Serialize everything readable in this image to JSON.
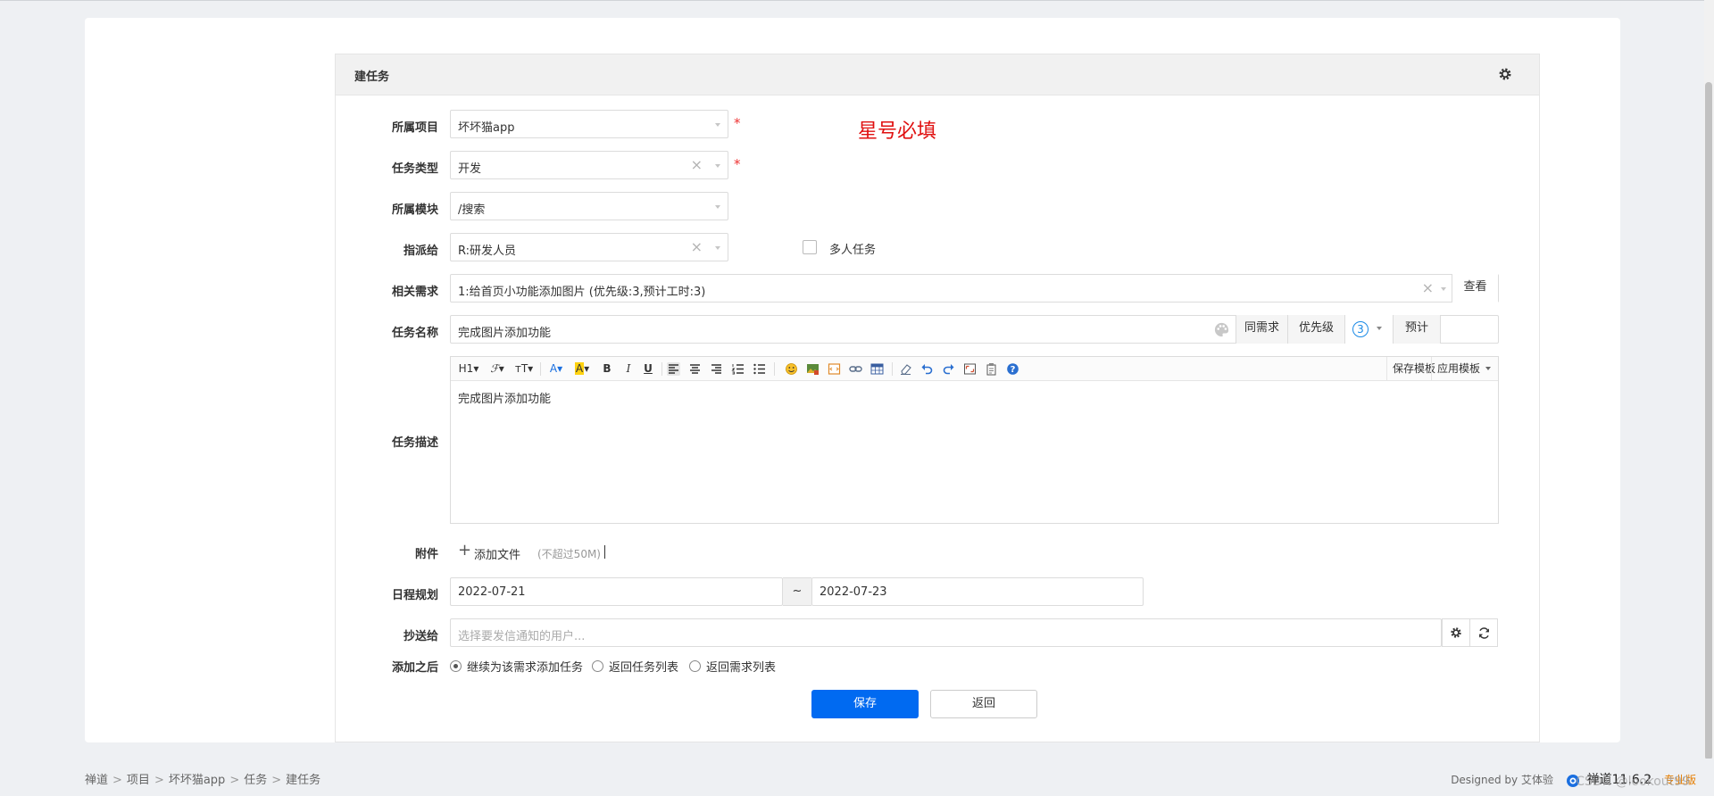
{
  "panel": {
    "title": "建任务"
  },
  "note": "星号必填",
  "required_mark": "*",
  "form": {
    "project": {
      "label": "所属项目",
      "value": "坏坏猫app"
    },
    "task_type": {
      "label": "任务类型",
      "value": "开发"
    },
    "module": {
      "label": "所属模块",
      "value": "/搜索"
    },
    "assign": {
      "label": "指派给",
      "value": "R:研发人员",
      "multi_label": "多人任务"
    },
    "story": {
      "label": "相关需求",
      "value": "1:给首页小功能添加图片 (优先级:3,预计工时:3)",
      "view_label": "查看"
    },
    "name": {
      "label": "任务名称",
      "value": "完成图片添加功能",
      "same_story_label": "同需求",
      "priority_label": "优先级",
      "priority_value": "3",
      "estimate_label": "预计"
    },
    "desc": {
      "label": "任务描述",
      "content": "完成图片添加功能",
      "save_template_label": "保存模板",
      "apply_template_label": "应用模板"
    },
    "attachment": {
      "label": "附件",
      "add_label": "添加文件",
      "limit": "(不超过50M)"
    },
    "schedule": {
      "label": "日程规划",
      "start": "2022-07-21",
      "sep": "~",
      "end": "2022-07-23"
    },
    "cc": {
      "label": "抄送给",
      "placeholder": "选择要发信通知的用户..."
    },
    "after": {
      "label": "添加之后",
      "options": [
        "继续为该需求添加任务",
        "返回任务列表",
        "返回需求列表"
      ],
      "selected_index": 0
    }
  },
  "toolbar": {
    "items": [
      "H1",
      "F",
      "TT",
      "A",
      "A",
      "B",
      "I",
      "U"
    ]
  },
  "buttons": {
    "save": "保存",
    "back": "返回"
  },
  "breadcrumb": [
    "禅道",
    "项目",
    "坏坏猫app",
    "任务",
    "建任务"
  ],
  "footer": {
    "designed_by": "Designed by 艾体验",
    "product": "禅道11.6.2",
    "edition": "专业版"
  },
  "watermark": "CSDN @lookout99",
  "colors": {
    "primary": "#006af1",
    "required": "#e33333",
    "note": "#e01010",
    "priority": "#1a8ae6"
  }
}
